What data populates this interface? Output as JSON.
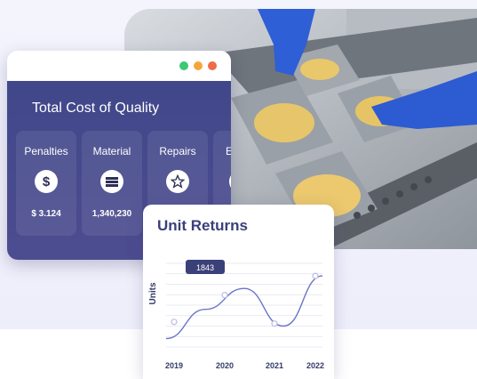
{
  "window_controls": {
    "colors": [
      "#3ec776",
      "#f7a53a",
      "#ef6b4a"
    ]
  },
  "cost_card": {
    "title": "Total Cost of Quality",
    "tiles": [
      {
        "label": "Penalties",
        "icon": "dollar-icon",
        "value": "$ 3.124"
      },
      {
        "label": "Material",
        "icon": "material-stack-icon",
        "value": "1,340,230"
      },
      {
        "label": "Repairs",
        "icon": "star-icon",
        "value": ""
      },
      {
        "label": "El",
        "icon": "partial-icon",
        "value": ""
      }
    ]
  },
  "unit_returns": {
    "title": "Unit Returns",
    "tooltip": "1843",
    "chart_data": {
      "type": "line",
      "title": "Unit Returns",
      "xlabel": "",
      "ylabel": "Units",
      "x": [
        "2019",
        "2020",
        "2021",
        "2022"
      ],
      "tick_labels": [
        "2019",
        "2020",
        "2021",
        "2022"
      ],
      "series": [
        {
          "values": [
            0.1,
            0.45,
            0.7,
            0.25,
            0.85
          ]
        }
      ],
      "marked_points": [
        0.3,
        0.62,
        0.28,
        0.85
      ],
      "grid": true,
      "line_color": "#6b74c4"
    }
  }
}
